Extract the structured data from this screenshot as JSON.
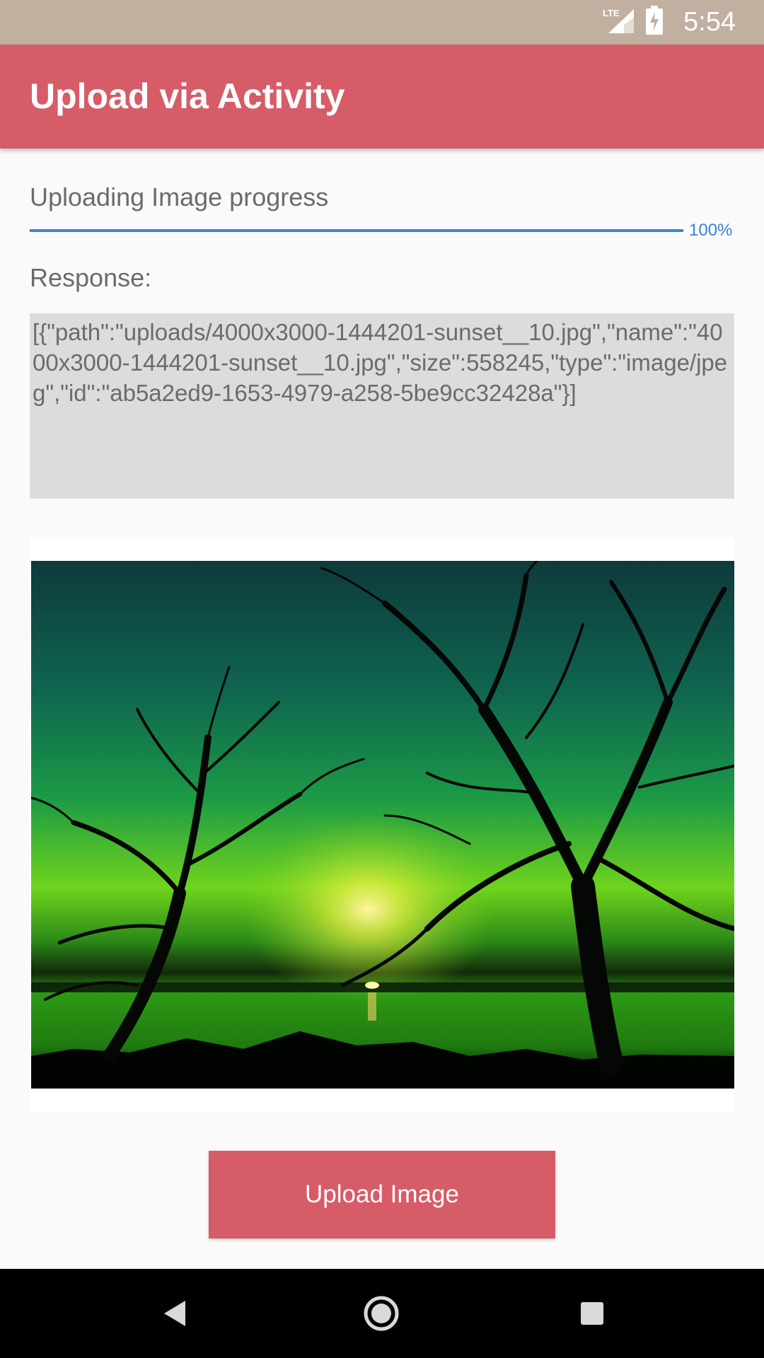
{
  "status_bar": {
    "network_label": "LTE",
    "time": "5:54"
  },
  "app_bar": {
    "title": "Upload via Activity"
  },
  "progress": {
    "label": "Uploading Image progress",
    "percent_text": "100%",
    "fraction": 1.0
  },
  "response": {
    "label": "Response:",
    "text": "[{\"path\":\"uploads/4000x3000-1444201-sunset__10.jpg\",\"name\":\"4000x3000-1444201-sunset__10.jpg\",\"size\":558245,\"type\":\"image/jpeg\",\"id\":\"ab5a2ed9-1653-4979-a258-5be9cc32428a\"}]"
  },
  "upload_button": {
    "label": "Upload Image"
  },
  "colors": {
    "status_bar": "#c1afa0",
    "accent": "#d65c68",
    "progress": "#3c83d9"
  },
  "icons": {
    "signal": "lte-signal-icon",
    "battery": "battery-charging-icon",
    "back": "back-icon",
    "home": "home-icon",
    "recents": "recents-icon"
  }
}
